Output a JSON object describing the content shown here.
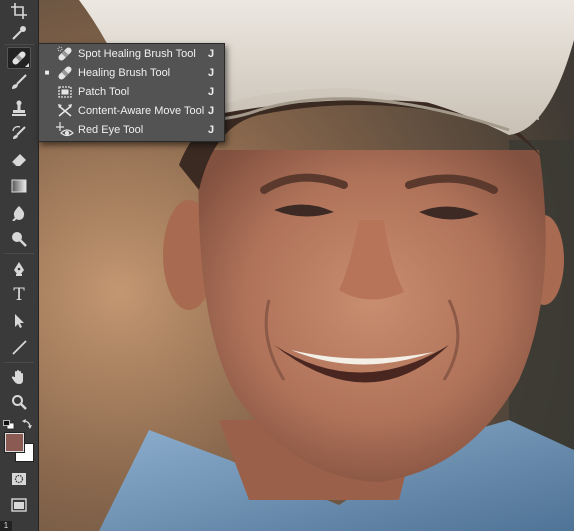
{
  "toolbar": {
    "tools": [
      {
        "name": "crop-tool",
        "icon": "crop-icon"
      },
      {
        "name": "eyedropper-tool",
        "icon": "eyedropper-icon"
      },
      {
        "name": "healing-brush-tool",
        "icon": "bandage-icon",
        "active": true
      },
      {
        "name": "brush-tool",
        "icon": "brush-icon"
      },
      {
        "name": "clone-stamp-tool",
        "icon": "stamp-icon"
      },
      {
        "name": "history-brush-tool",
        "icon": "history-brush-icon"
      },
      {
        "name": "eraser-tool",
        "icon": "eraser-icon"
      },
      {
        "name": "gradient-tool",
        "icon": "gradient-icon"
      },
      {
        "name": "blur-tool",
        "icon": "blur-icon"
      },
      {
        "name": "dodge-tool",
        "icon": "dodge-icon"
      },
      {
        "name": "pen-tool",
        "icon": "pen-icon"
      },
      {
        "name": "type-tool",
        "icon": "type-icon",
        "glyph": "T"
      },
      {
        "name": "path-selection-tool",
        "icon": "arrow-icon"
      },
      {
        "name": "line-tool",
        "icon": "line-icon"
      },
      {
        "name": "hand-tool",
        "icon": "hand-icon"
      },
      {
        "name": "zoom-tool",
        "icon": "zoom-icon"
      }
    ],
    "foreground_color": "#8b5a52",
    "background_color": "#ffffff",
    "corner_badge": "1"
  },
  "flyout": {
    "items": [
      {
        "label": "Spot Healing Brush Tool",
        "shortcut": "J",
        "icon": "spot-healing-icon",
        "selected": false
      },
      {
        "label": "Healing Brush Tool",
        "shortcut": "J",
        "icon": "healing-brush-icon",
        "selected": true
      },
      {
        "label": "Patch Tool",
        "shortcut": "J",
        "icon": "patch-icon",
        "selected": false
      },
      {
        "label": "Content-Aware Move Tool",
        "shortcut": "J",
        "icon": "content-aware-move-icon",
        "selected": false
      },
      {
        "label": "Red Eye Tool",
        "shortcut": "J",
        "icon": "red-eye-icon",
        "selected": false
      }
    ],
    "selected_marker": "■"
  },
  "canvas": {
    "subject": "photo-portrait"
  }
}
